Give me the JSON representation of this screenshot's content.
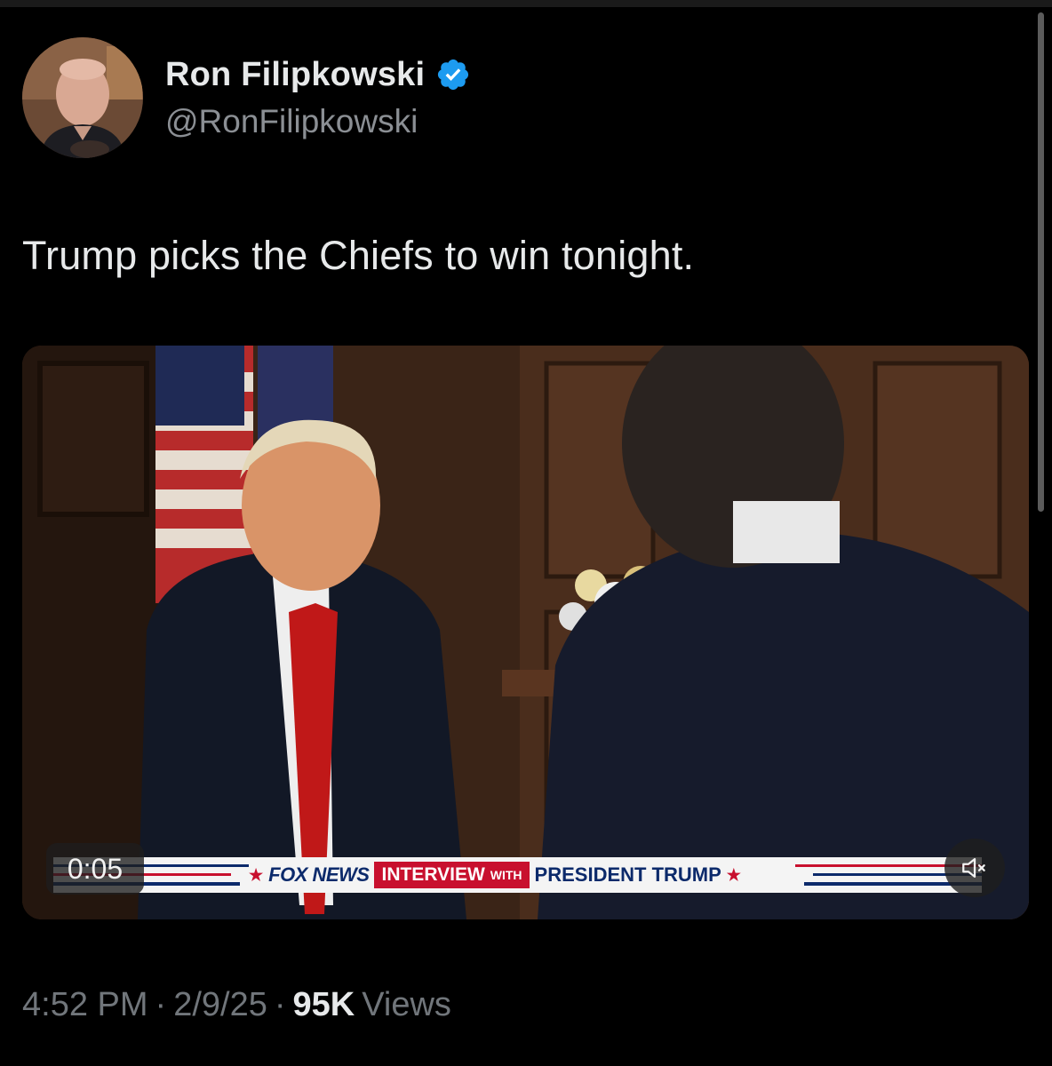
{
  "tweet": {
    "author": {
      "display_name": "Ron Filipkowski",
      "handle": "@RonFilipkowski",
      "verified_icon": "verified-badge-icon"
    },
    "text": "Trump picks the Chiefs to win tonight.",
    "video": {
      "timestamp": "0:05",
      "mute_icon": "speaker-muted-icon",
      "chyron": {
        "network": "FOX NEWS",
        "interview": "INTERVIEW",
        "with": "WITH",
        "subject": "PRESIDENT TRUMP"
      }
    },
    "meta": {
      "time": "4:52 PM",
      "separator": "·",
      "date": "2/9/25",
      "views_count": "95K",
      "views_label": "Views"
    }
  },
  "colors": {
    "background": "#000000",
    "primary_text": "#e7e9ea",
    "secondary_text": "#71767b",
    "verified_blue": "#1d9bf0",
    "fox_red": "#c8102e",
    "fox_blue": "#0c2a6b"
  }
}
